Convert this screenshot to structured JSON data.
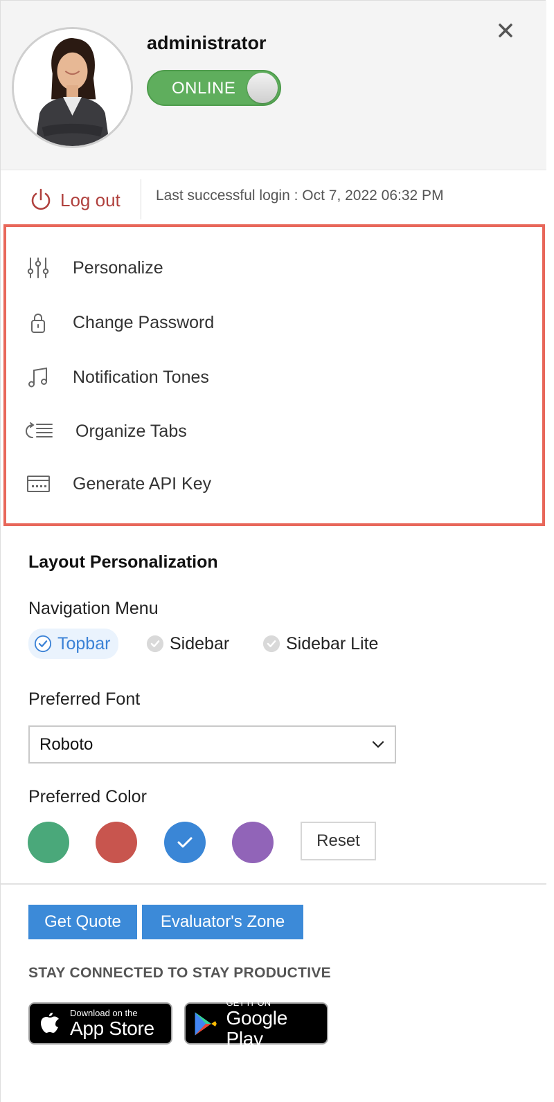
{
  "profile": {
    "username": "administrator",
    "status_label": "ONLINE",
    "close_icon": "close-icon",
    "avatar": "user-avatar"
  },
  "session": {
    "logout_label": "Log out",
    "last_login": "Last successful login : Oct 7, 2022 06:32 PM"
  },
  "menu": {
    "items": [
      {
        "label": "Personalize",
        "icon": "sliders-icon"
      },
      {
        "label": "Change Password",
        "icon": "lock-icon"
      },
      {
        "label": "Notification Tones",
        "icon": "music-note-icon"
      },
      {
        "label": "Organize Tabs",
        "icon": "reorder-list-icon"
      },
      {
        "label": "Generate API Key",
        "icon": "api-key-icon"
      }
    ],
    "highlight_color": "#e8675a"
  },
  "layout": {
    "title": "Layout Personalization",
    "nav_label": "Navigation Menu",
    "nav_options": [
      {
        "label": "Topbar",
        "selected": true
      },
      {
        "label": "Sidebar",
        "selected": false
      },
      {
        "label": "Sidebar Lite",
        "selected": false
      }
    ],
    "font_label": "Preferred Font",
    "font_value": "Roboto",
    "color_label": "Preferred Color",
    "colors": [
      {
        "hex": "#4aa87a",
        "selected": false
      },
      {
        "hex": "#c8554e",
        "selected": false
      },
      {
        "hex": "#3a86d6",
        "selected": true
      },
      {
        "hex": "#9164b8",
        "selected": false
      }
    ],
    "reset_label": "Reset"
  },
  "footer": {
    "get_quote": "Get Quote",
    "evaluators_zone": "Evaluator's Zone",
    "stay_connected": "STAY CONNECTED TO STAY PRODUCTIVE",
    "app_store": {
      "small": "Download on the",
      "big": "App Store"
    },
    "google_play": {
      "small": "GET IT ON",
      "big": "Google Play"
    },
    "accent": "#3c8ad8"
  }
}
